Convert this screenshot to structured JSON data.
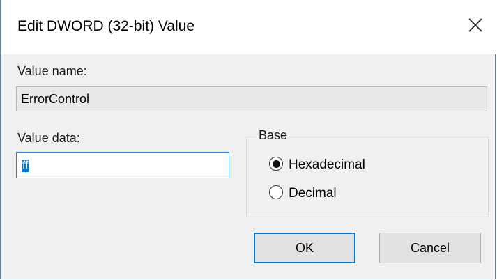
{
  "dialog": {
    "title": "Edit DWORD (32-bit) Value",
    "close_icon": "close-icon"
  },
  "value_name": {
    "label": "Value name:",
    "value": "ErrorControl"
  },
  "value_data": {
    "label": "Value data:",
    "value": "ff"
  },
  "base": {
    "label": "Base",
    "options": [
      {
        "label": "Hexadecimal",
        "selected": true
      },
      {
        "label": "Decimal",
        "selected": false
      }
    ]
  },
  "buttons": {
    "ok": "OK",
    "cancel": "Cancel"
  },
  "colors": {
    "accent": "#0078d7",
    "dialog_bg": "#f0f0f0"
  }
}
